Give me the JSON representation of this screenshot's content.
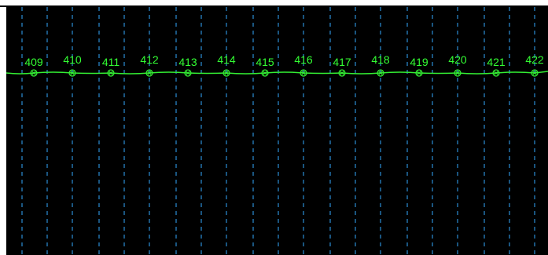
{
  "viewport": {
    "background": "#000000",
    "gridline_color": "#33aaff",
    "profile_color": "#33ee33"
  },
  "stations": [
    {
      "label": "409",
      "icon": "station-marker-icon"
    },
    {
      "label": "410",
      "icon": "station-marker-icon"
    },
    {
      "label": "411",
      "icon": "station-marker-icon"
    },
    {
      "label": "412",
      "icon": "station-marker-icon"
    },
    {
      "label": "413",
      "icon": "station-marker-icon"
    },
    {
      "label": "414",
      "icon": "station-marker-icon"
    },
    {
      "label": "415",
      "icon": "station-marker-icon"
    },
    {
      "label": "416",
      "icon": "station-marker-icon"
    },
    {
      "label": "417",
      "icon": "station-marker-icon"
    },
    {
      "label": "418",
      "icon": "station-marker-icon"
    },
    {
      "label": "419",
      "icon": "station-marker-icon"
    },
    {
      "label": "420",
      "icon": "station-marker-icon"
    },
    {
      "label": "421",
      "icon": "station-marker-icon"
    },
    {
      "label": "422",
      "icon": "station-marker-icon"
    }
  ]
}
